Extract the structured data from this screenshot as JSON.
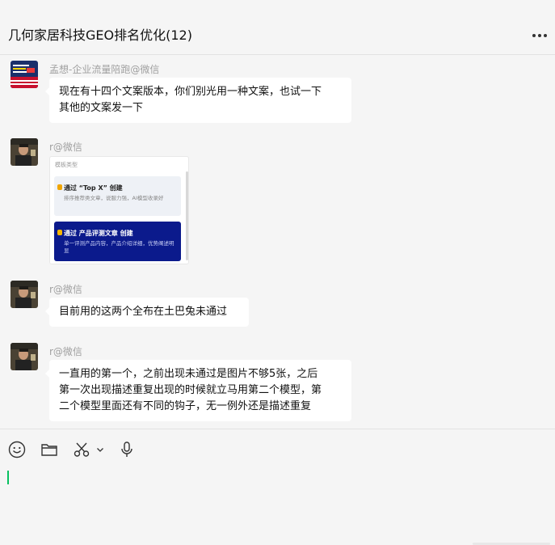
{
  "window": {
    "title": "几何家居科技GEO排名优化(12)"
  },
  "messages": [
    {
      "sender": "孟想-企业流量陪跑@微信",
      "lines": [
        "现在有十四个文案版本，你们别光用一种文案，也试一下",
        "其他的文案发一下"
      ]
    },
    {
      "sender": "r@微信",
      "image": {
        "label": "模板类型",
        "options": [
          {
            "title": "通过 “Top X” 创建",
            "desc": "排序推荐类文章，说服力强，AI模型收录好"
          },
          {
            "title": "通过 产品评测文章 创建",
            "desc": "单一评测产品内容，产品介绍详细，优势阐述明显"
          }
        ]
      }
    },
    {
      "sender": "r@微信",
      "lines": [
        "目前用的这两个全布在土巴兔未通过"
      ]
    },
    {
      "sender": "r@微信",
      "lines": [
        "一直用的第一个，之前出现未通过是图片不够5张，之后",
        "第一次出现描述重复出现的时候就立马用第二个模型，第",
        "二个模型里面还有不同的钩子，无一例外还是描述重复"
      ]
    }
  ],
  "colors": {
    "accent": "#07c160",
    "option_selected": "#0b1a8c",
    "option_default": "#eef1f6"
  },
  "icons": [
    "pin-icon",
    "minimize-icon",
    "maximize-icon",
    "close-icon",
    "more-icon",
    "emoji-icon",
    "folder-icon",
    "scissors-icon",
    "chevron-down-icon",
    "microphone-icon"
  ]
}
